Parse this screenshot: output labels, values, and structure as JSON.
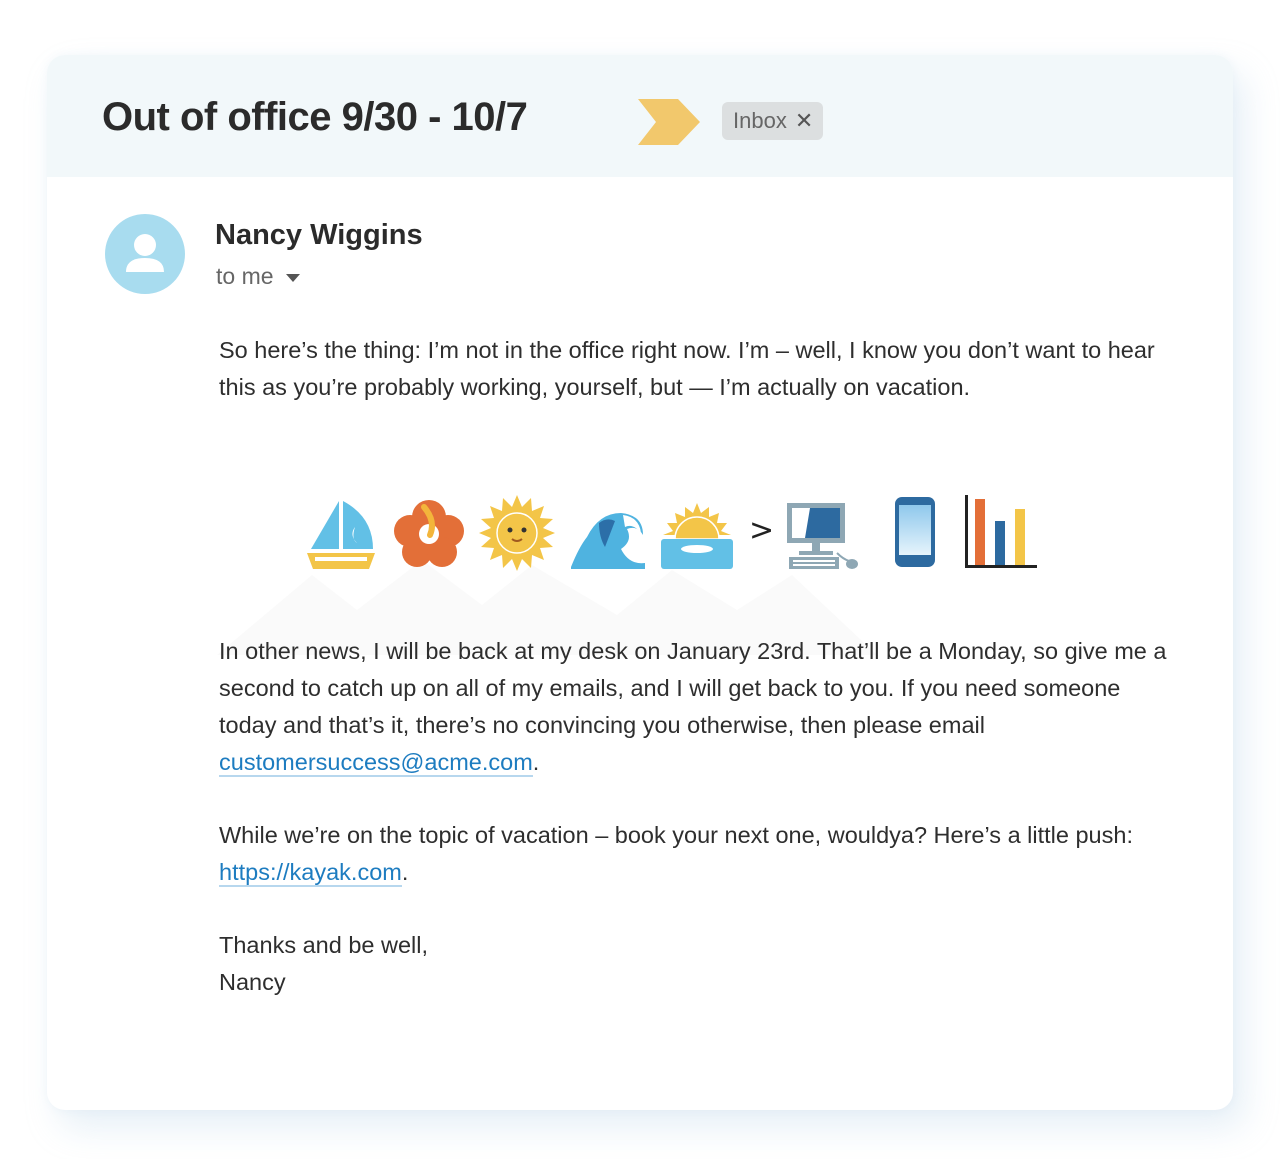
{
  "email": {
    "subject": "Out of office 9/30 - 10/7",
    "importance_marker": "important-chevron",
    "labels": [
      {
        "name": "Inbox",
        "remove_glyph": "✕"
      }
    ],
    "sender": {
      "name": "Nancy Wiggins",
      "avatar": "person-icon",
      "recipient_label": "to me"
    },
    "body": {
      "paragraph1": "So here’s the thing: I’m not in the office right now. I’m – well, I know you don’t want to hear this as you’re probably working, yourself, but — I’m actually on vacation.",
      "emoji_strip": {
        "items": [
          "sailboat",
          "hibiscus",
          "sun-with-face",
          "water-wave",
          "sunrise",
          "greater-than",
          "desktop-computer",
          "mobile-phone",
          "bar-chart"
        ],
        "separator_text": ">"
      },
      "paragraph2_before_link": "In other news, I will be back at my desk on January 23rd. That’ll be a Monday, so give me a second to catch up on all of my emails, and I will get back to you. If you need someone today and that’s it, there’s no convincing you otherwise, then please email ",
      "email_link": "customersuccess@acme.com",
      "paragraph2_after_link": ".",
      "paragraph3_before_link": "While we’re on the topic of vacation – book your next one, wouldya? Here’s a little push: ",
      "web_link": "https://kayak.com",
      "paragraph3_after_link": ".",
      "signoff": "Thanks and be well,",
      "signature": "Nancy"
    }
  },
  "colors": {
    "header_bg": "#f2f8fa",
    "importance": "#f2c86c",
    "avatar": "#a8dcef",
    "link": "#1d7cc0",
    "chip_bg": "#dcdfe0"
  }
}
